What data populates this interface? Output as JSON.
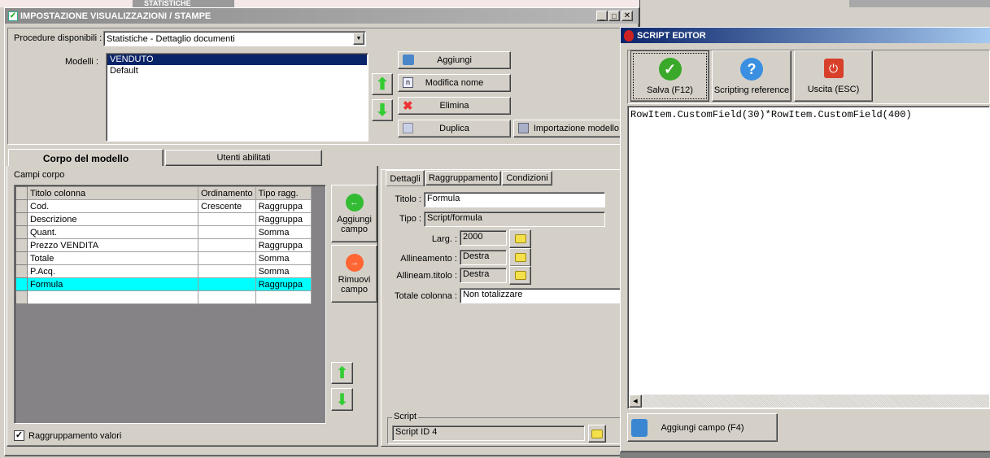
{
  "background_window": {
    "title": "STATISTICHE"
  },
  "main_window": {
    "title": "IMPOSTAZIONE VISUALIZZAZIONI / STAMPE",
    "procedure_label": "Procedure disponibili :",
    "procedure_value": "Statistiche - Dettaglio documenti",
    "modelli_label": "Modelli :",
    "modelli": [
      "VENDUTO",
      "Default"
    ],
    "buttons": {
      "aggiungi": "Aggiungi",
      "modifica_nome": "Modifica nome",
      "elimina": "Elimina",
      "duplica": "Duplica",
      "importazione": "Importazione modello"
    },
    "tabs": [
      "Corpo del modello",
      "Utenti abilitati"
    ],
    "campi_corpo_label": "Campi corpo",
    "grid": {
      "columns": [
        "Titolo colonna",
        "Ordinamento",
        "Tipo ragg."
      ],
      "rows": [
        [
          "Cod.",
          "Crescente",
          "Raggruppa"
        ],
        [
          "Descrizione",
          "",
          "Raggruppa"
        ],
        [
          "Quant.",
          "",
          "Somma"
        ],
        [
          "Prezzo VENDITA",
          "",
          "Raggruppa"
        ],
        [
          "Totale",
          "",
          "Somma"
        ],
        [
          "P.Acq.",
          "",
          "Somma"
        ],
        [
          "Formula",
          "",
          "Raggruppa"
        ]
      ]
    },
    "aggiungi_campo": "Aggiungi campo",
    "rimuovi_campo": "Rimuovi campo",
    "raggruppamento_label": "Raggruppamento valori",
    "raggruppamento_checked": true,
    "detail_tabs": [
      "Dettagli",
      "Raggruppamento",
      "Condizioni"
    ],
    "details": {
      "titolo_label": "Titolo :",
      "titolo": "Formula",
      "tipo_label": "Tipo :",
      "tipo": "Script/formula",
      "larg_label": "Larg. :",
      "larg": "2000",
      "allineamento_label": "Allineamento :",
      "allineamento": "Destra",
      "allineam_titolo_label": "Allineam.titolo :",
      "allineam_titolo": "Destra",
      "totale_label": "Totale colonna :",
      "totale": "Non totalizzare"
    },
    "script_group": "Script",
    "script_value": "Script ID 4"
  },
  "script_editor": {
    "title": "SCRIPT EDITOR",
    "salva": "Salva (F12)",
    "reference": "Scripting reference",
    "uscita": "Uscita (ESC)",
    "code": "RowItem.CustomField(30)*RowItem.CustomField(400)",
    "aggiungi_campo": "Aggiungi campo (F4)"
  }
}
